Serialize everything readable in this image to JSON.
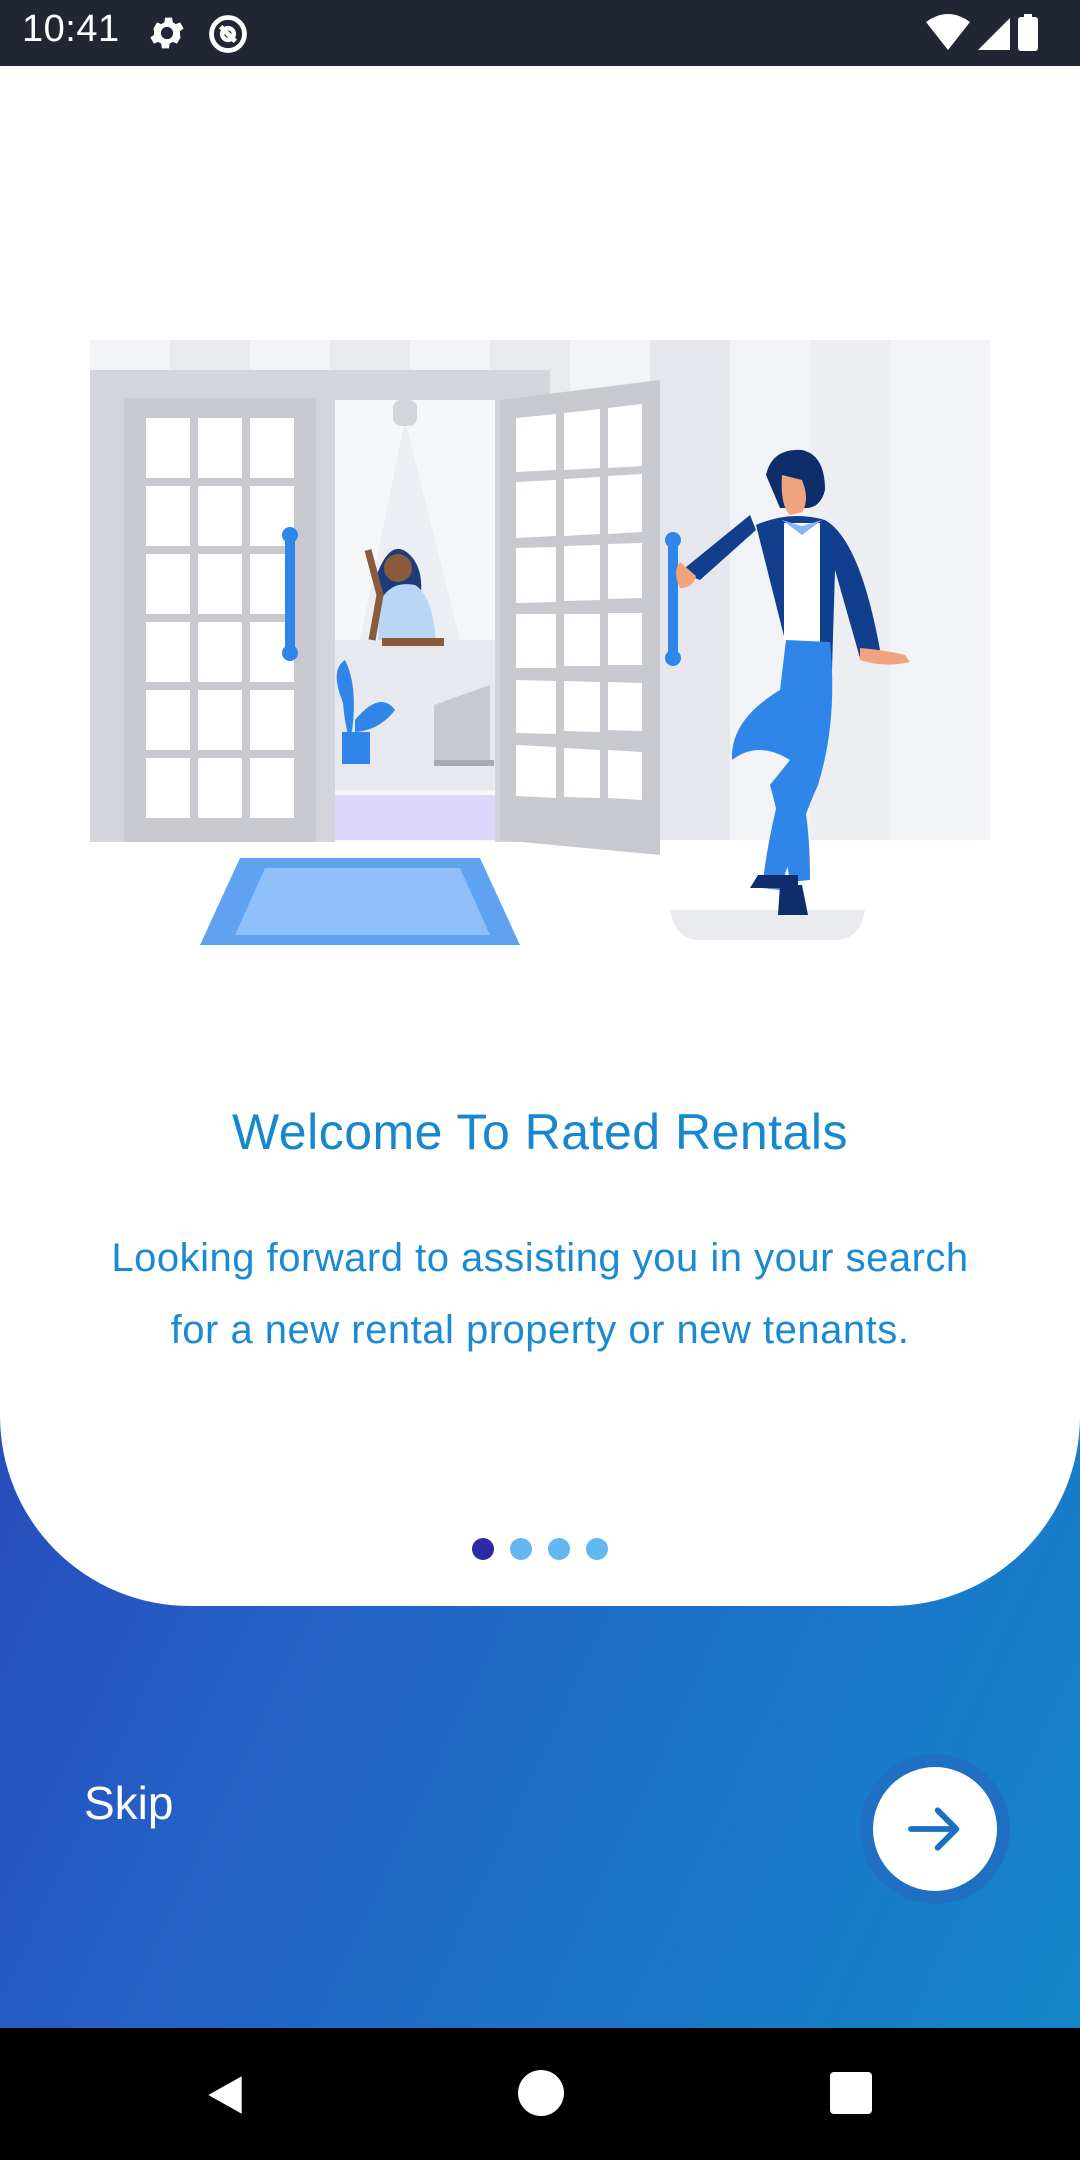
{
  "status_bar": {
    "time": "10:41",
    "icons": [
      "gear-icon",
      "alt-circle-icon",
      "wifi-icon",
      "signal-icon",
      "battery-icon"
    ]
  },
  "onboarding": {
    "title": "Welcome To Rated Rentals",
    "description": "Looking forward to assisting you in your search for a new rental property or new tenants.",
    "page_indicator": {
      "total": 4,
      "current": 1
    },
    "skip_label": "Skip",
    "next_icon": "arrow-right-icon"
  },
  "colors": {
    "accent_text": "#1787cf",
    "gradient_start": "#2f2aa7",
    "gradient_end": "#1386c9",
    "dot_active": "#2d2ba4",
    "dot_inactive": "#63b6f0"
  },
  "nav_bar": {
    "icons": [
      "back-icon",
      "home-icon",
      "recents-icon"
    ]
  }
}
